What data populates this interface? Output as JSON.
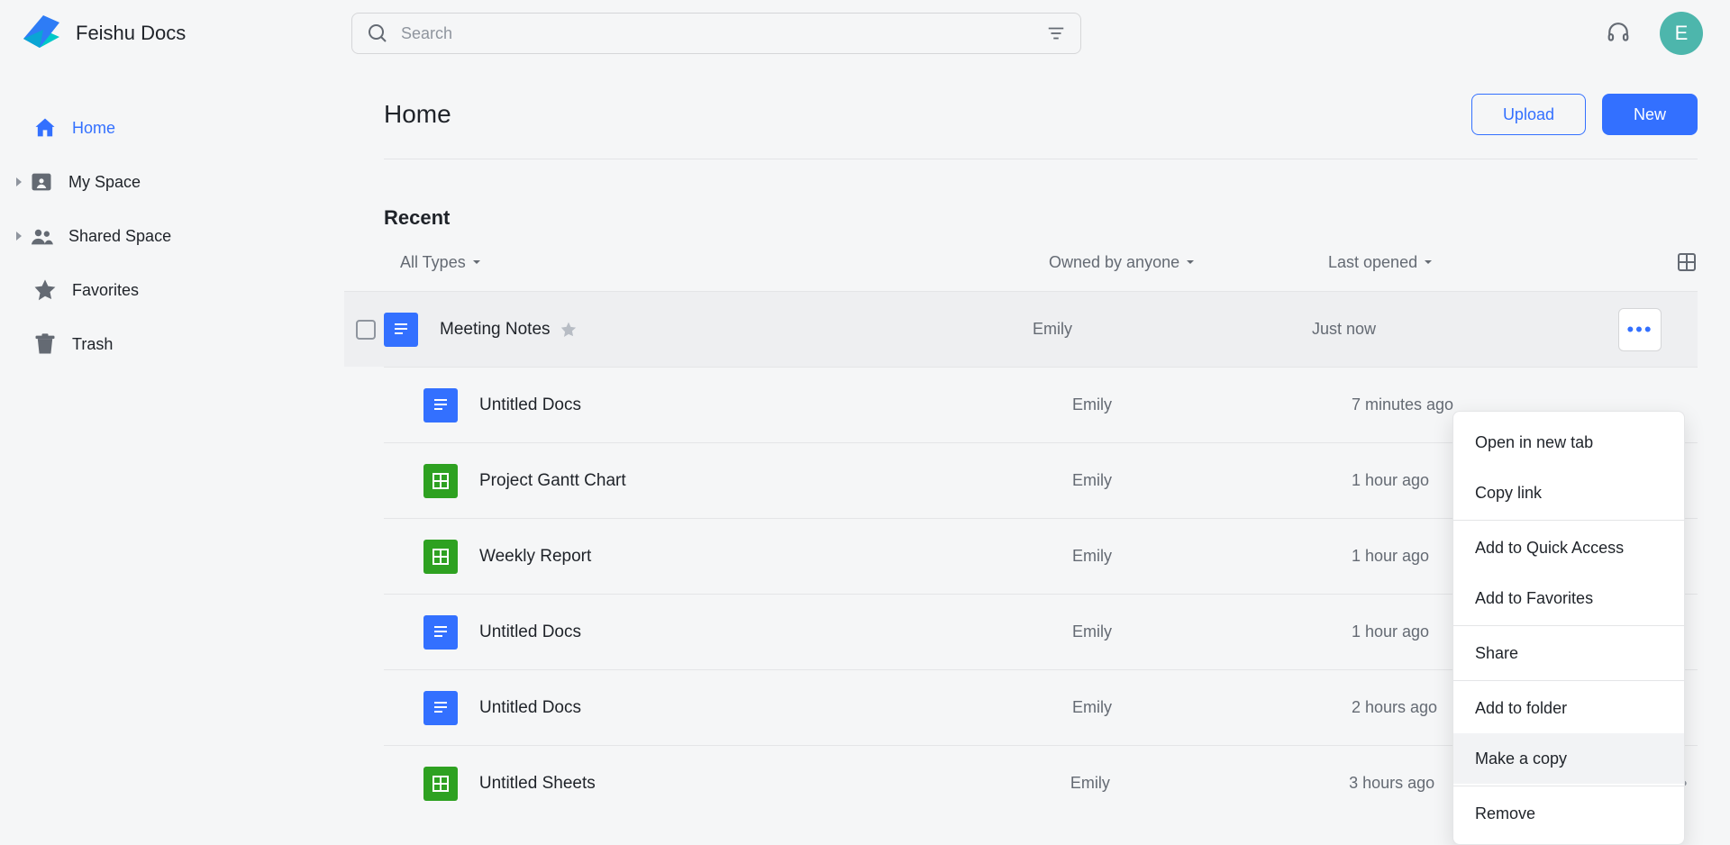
{
  "brand": {
    "name": "Feishu Docs"
  },
  "search": {
    "placeholder": "Search"
  },
  "avatar": {
    "initial": "E"
  },
  "sidebar": {
    "items": [
      {
        "label": "Home"
      },
      {
        "label": "My Space"
      },
      {
        "label": "Shared Space"
      },
      {
        "label": "Favorites"
      },
      {
        "label": "Trash"
      }
    ]
  },
  "page": {
    "title": "Home"
  },
  "buttons": {
    "upload": "Upload",
    "new": "New"
  },
  "section": {
    "recent": "Recent"
  },
  "filters": {
    "type": "All Types",
    "owner": "Owned by anyone",
    "time": "Last opened"
  },
  "files": [
    {
      "name": "Meeting Notes",
      "type": "doc",
      "owner": "Emily",
      "time": "Just now",
      "starred": true
    },
    {
      "name": "Untitled Docs",
      "type": "doc",
      "owner": "Emily",
      "time": "7 minutes ago",
      "starred": false
    },
    {
      "name": "Project Gantt Chart",
      "type": "sheet",
      "owner": "Emily",
      "time": "1 hour ago",
      "starred": false
    },
    {
      "name": "Weekly Report",
      "type": "sheet",
      "owner": "Emily",
      "time": "1 hour ago",
      "starred": false
    },
    {
      "name": "Untitled Docs",
      "type": "doc",
      "owner": "Emily",
      "time": "1 hour ago",
      "starred": false
    },
    {
      "name": "Untitled Docs",
      "type": "doc",
      "owner": "Emily",
      "time": "2 hours ago",
      "starred": false
    },
    {
      "name": "Untitled Sheets",
      "type": "sheet",
      "owner": "Emily",
      "time": "3 hours ago",
      "starred": false
    }
  ],
  "context_menu": [
    "Open in new tab",
    "Copy link",
    "-",
    "Add to Quick Access",
    "Add to Favorites",
    "-",
    "Share",
    "-",
    "Add to folder",
    "Make a copy",
    "-",
    "Remove"
  ]
}
